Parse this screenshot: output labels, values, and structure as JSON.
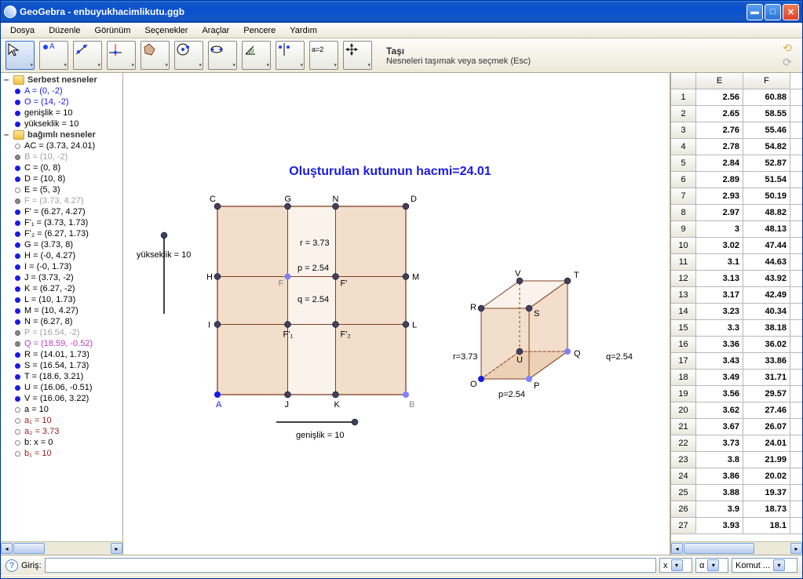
{
  "window": {
    "title": "GeoGebra - enbuyukhacimlikutu.ggb"
  },
  "menu": [
    "Dosya",
    "Düzenle",
    "Görünüm",
    "Seçenekler",
    "Araçlar",
    "Pencere",
    "Yardım"
  ],
  "tool": {
    "name": "Taşı",
    "help": "Nesneleri taşımak veya seçmek (Esc)"
  },
  "algebra": {
    "free_label": "Serbest nesneler",
    "free": [
      {
        "txt": "A = (0, -2)",
        "cls": "txt-blue",
        "b": "b-filled"
      },
      {
        "txt": "O = (14, -2)",
        "cls": "txt-blue",
        "b": "b-filled"
      },
      {
        "txt": "genişlik = 10",
        "cls": "txt-black",
        "b": "b-filled"
      },
      {
        "txt": "yükseklik = 10",
        "cls": "txt-black",
        "b": "b-filled"
      }
    ],
    "dep_label": "bağımlı nesneler",
    "dep": [
      {
        "txt": "AC = (3.73, 24.01)",
        "cls": "txt-black",
        "b": "b-hollow"
      },
      {
        "txt": "B = (10, -2)",
        "cls": "txt-gray",
        "b": "b-gray"
      },
      {
        "txt": "C = (0, 8)",
        "cls": "txt-black",
        "b": "b-filled"
      },
      {
        "txt": "D = (10, 8)",
        "cls": "txt-black",
        "b": "b-filled"
      },
      {
        "txt": "E = (5, 3)",
        "cls": "txt-black",
        "b": "b-hollow"
      },
      {
        "txt": "F = (3.73, 4.27)",
        "cls": "txt-gray",
        "b": "b-gray"
      },
      {
        "txt": "F' = (6.27, 4.27)",
        "cls": "txt-black",
        "b": "b-filled"
      },
      {
        "txt": "F'₁ = (3.73, 1.73)",
        "cls": "txt-black",
        "b": "b-filled"
      },
      {
        "txt": "F'₂ = (6.27, 1.73)",
        "cls": "txt-black",
        "b": "b-filled"
      },
      {
        "txt": "G = (3.73, 8)",
        "cls": "txt-black",
        "b": "b-filled"
      },
      {
        "txt": "H = (-0, 4.27)",
        "cls": "txt-black",
        "b": "b-filled"
      },
      {
        "txt": "I = (-0, 1.73)",
        "cls": "txt-black",
        "b": "b-filled"
      },
      {
        "txt": "J = (3.73, -2)",
        "cls": "txt-black",
        "b": "b-filled"
      },
      {
        "txt": "K = (6.27, -2)",
        "cls": "txt-black",
        "b": "b-filled"
      },
      {
        "txt": "L = (10, 1.73)",
        "cls": "txt-black",
        "b": "b-filled"
      },
      {
        "txt": "M = (10, 4.27)",
        "cls": "txt-black",
        "b": "b-filled"
      },
      {
        "txt": "N = (6.27, 8)",
        "cls": "txt-black",
        "b": "b-filled"
      },
      {
        "txt": "P = (16.54, -2)",
        "cls": "txt-gray",
        "b": "b-gray"
      },
      {
        "txt": "Q = (18.59, -0.52)",
        "cls": "txt-purple",
        "b": "b-gray"
      },
      {
        "txt": "R = (14.01, 1.73)",
        "cls": "txt-black",
        "b": "b-filled"
      },
      {
        "txt": "S = (16.54, 1.73)",
        "cls": "txt-black",
        "b": "b-filled"
      },
      {
        "txt": "T = (18.6, 3.21)",
        "cls": "txt-black",
        "b": "b-filled"
      },
      {
        "txt": "U = (16.06, -0.51)",
        "cls": "txt-black",
        "b": "b-filled"
      },
      {
        "txt": "V = (16.06, 3.22)",
        "cls": "txt-black",
        "b": "b-filled"
      },
      {
        "txt": "a = 10",
        "cls": "txt-black",
        "b": "b-hollow"
      },
      {
        "txt": "a₁ = 10",
        "cls": "txt-dkred",
        "b": "b-hollow"
      },
      {
        "txt": "a₂ = 3.73",
        "cls": "txt-dkred",
        "b": "b-hollow"
      },
      {
        "txt": "b: x = 0",
        "cls": "txt-black",
        "b": "b-hollow"
      },
      {
        "txt": "b₁ = 10",
        "cls": "txt-dkred",
        "b": "b-hollow"
      }
    ]
  },
  "graphics": {
    "title": "Oluşturulan kutunun hacmi=24.01",
    "width_label": "genişlik = 10",
    "height_label": "yükseklik = 10",
    "r_label": "r = 3.73",
    "p_label": "p = 2.54",
    "q_label": "q = 2.54",
    "box_r": "r=3.73",
    "box_p": "p=2.54",
    "box_q": "q=2.54",
    "pts2d": {
      "A": "A",
      "B": "B",
      "C": "C",
      "D": "D",
      "G": "G",
      "N": "N",
      "H": "H",
      "M": "M",
      "I": "I",
      "L": "L",
      "J": "J",
      "K": "K",
      "F": "F",
      "Fp": "F'",
      "Fp1": "F'₁",
      "Fp2": "F'₂"
    },
    "pts3d": {
      "O": "O",
      "P": "P",
      "Q": "Q",
      "R": "R",
      "S": "S",
      "T": "T",
      "U": "U",
      "V": "V"
    }
  },
  "spreadsheet": {
    "cols": [
      "E",
      "F"
    ],
    "rows": [
      [
        1,
        "2.56",
        "60.88"
      ],
      [
        2,
        "2.65",
        "58.55"
      ],
      [
        3,
        "2.76",
        "55.46"
      ],
      [
        4,
        "2.78",
        "54.82"
      ],
      [
        5,
        "2.84",
        "52.87"
      ],
      [
        6,
        "2.89",
        "51.54"
      ],
      [
        7,
        "2.93",
        "50.19"
      ],
      [
        8,
        "2.97",
        "48.82"
      ],
      [
        9,
        "3",
        "48.13"
      ],
      [
        10,
        "3.02",
        "47.44"
      ],
      [
        11,
        "3.1",
        "44.63"
      ],
      [
        12,
        "3.13",
        "43.92"
      ],
      [
        13,
        "3.17",
        "42.49"
      ],
      [
        14,
        "3.23",
        "40.34"
      ],
      [
        15,
        "3.3",
        "38.18"
      ],
      [
        16,
        "3.36",
        "36.02"
      ],
      [
        17,
        "3.43",
        "33.86"
      ],
      [
        18,
        "3.49",
        "31.71"
      ],
      [
        19,
        "3.56",
        "29.57"
      ],
      [
        20,
        "3.62",
        "27.46"
      ],
      [
        21,
        "3.67",
        "26.07"
      ],
      [
        22,
        "3.73",
        "24.01"
      ],
      [
        23,
        "3.8",
        "21.99"
      ],
      [
        24,
        "3.86",
        "20.02"
      ],
      [
        25,
        "3.88",
        "19.37"
      ],
      [
        26,
        "3.9",
        "18.73"
      ],
      [
        27,
        "3.93",
        "18.1"
      ]
    ]
  },
  "input": {
    "label": "Giriş:",
    "sym1": "x",
    "sym2": "α",
    "cmd": "Komut ..."
  }
}
